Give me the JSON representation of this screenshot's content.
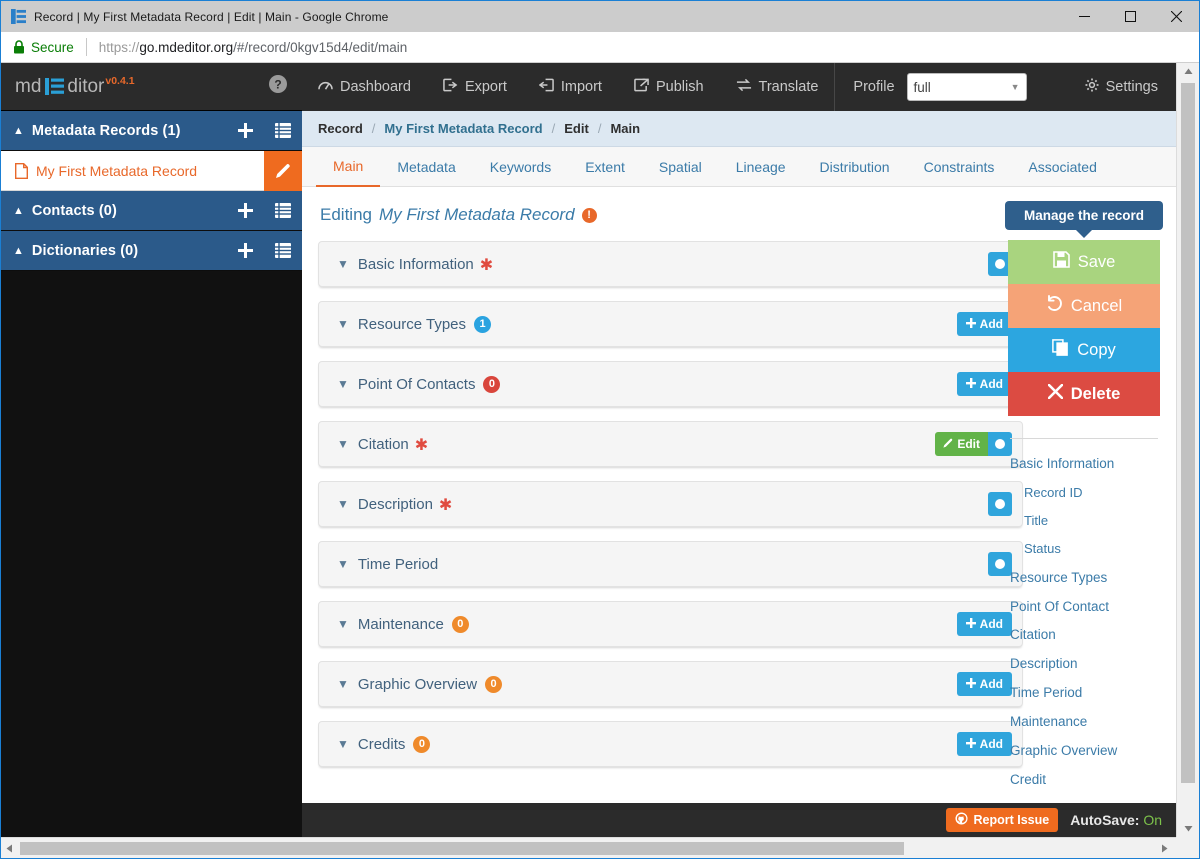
{
  "window": {
    "title": "Record | My First Metadata Record | Edit | Main - Google Chrome",
    "icon": "mdeditor-app-icon",
    "minimize": "minimize",
    "maximize": "maximize",
    "close": "close"
  },
  "browser": {
    "security_label": "Secure",
    "lock_icon": "lock-icon",
    "url_scheme": "https://",
    "url_domain": "go.mdeditor.org",
    "url_path": "/#/record/0kgv15d4/edit/main"
  },
  "brand": {
    "name_part1": "md",
    "logo_icon": "list-logo-icon",
    "name_part2": "ditor",
    "version": "v0.4.1",
    "help_icon": "help-circle-icon"
  },
  "sidebar": {
    "sections": [
      {
        "label": "Metadata Records (1)",
        "caret_icon": "chevron-up-icon",
        "add_icon": "plus-icon",
        "list_icon": "list-icon",
        "records": [
          {
            "label": "My First Metadata Record",
            "file_icon": "file-icon",
            "edit_icon": "pencil-icon"
          }
        ]
      },
      {
        "label": "Contacts (0)",
        "caret_icon": "chevron-up-icon",
        "add_icon": "plus-icon",
        "list_icon": "list-icon",
        "records": []
      },
      {
        "label": "Dictionaries (0)",
        "caret_icon": "chevron-up-icon",
        "add_icon": "plus-icon",
        "list_icon": "list-icon",
        "records": []
      }
    ]
  },
  "topnav": {
    "items": [
      {
        "label": "Dashboard",
        "icon": "dashboard-icon"
      },
      {
        "label": "Export",
        "icon": "export-icon"
      },
      {
        "label": "Import",
        "icon": "import-icon"
      },
      {
        "label": "Publish",
        "icon": "publish-icon"
      },
      {
        "label": "Translate",
        "icon": "translate-icon"
      }
    ],
    "profile_label": "Profile",
    "profile_value": "full",
    "profile_caret": "chevron-down-icon",
    "settings_label": "Settings",
    "settings_icon": "gear-icon"
  },
  "breadcrumb": {
    "items": [
      "Record",
      "My First Metadata Record",
      "Edit",
      "Main"
    ],
    "separator": "/"
  },
  "tabs": [
    {
      "label": "Main",
      "active": true
    },
    {
      "label": "Metadata",
      "active": false
    },
    {
      "label": "Keywords",
      "active": false
    },
    {
      "label": "Extent",
      "active": false
    },
    {
      "label": "Spatial",
      "active": false
    },
    {
      "label": "Lineage",
      "active": false
    },
    {
      "label": "Distribution",
      "active": false
    },
    {
      "label": "Constraints",
      "active": false
    },
    {
      "label": "Associated",
      "active": false
    }
  ],
  "editing": {
    "prefix": "Editing",
    "record_name": "My First Metadata Record",
    "warning_icon": "exclamation-circle-icon",
    "warning_glyph": "!"
  },
  "panels": [
    {
      "title": "Basic Information",
      "required": true,
      "badge": null,
      "badge_color": null,
      "action": "toggle",
      "caret_icon": "chevron-down-icon"
    },
    {
      "title": "Resource Types",
      "required": false,
      "badge": "1",
      "badge_color": "blue",
      "action": "add",
      "caret_icon": "chevron-down-icon"
    },
    {
      "title": "Point Of Contacts",
      "required": false,
      "badge": "0",
      "badge_color": "red",
      "action": "add",
      "caret_icon": "chevron-down-icon"
    },
    {
      "title": "Citation",
      "required": true,
      "badge": null,
      "badge_color": null,
      "action": "edit_toggle",
      "caret_icon": "chevron-down-icon"
    },
    {
      "title": "Description",
      "required": true,
      "badge": null,
      "badge_color": null,
      "action": "toggle",
      "caret_icon": "chevron-down-icon"
    },
    {
      "title": "Time Period",
      "required": false,
      "badge": null,
      "badge_color": null,
      "action": "toggle",
      "caret_icon": "chevron-down-icon"
    },
    {
      "title": "Maintenance",
      "required": false,
      "badge": "0",
      "badge_color": "orange",
      "action": "add",
      "caret_icon": "chevron-down-icon"
    },
    {
      "title": "Graphic Overview",
      "required": false,
      "badge": "0",
      "badge_color": "orange",
      "action": "add",
      "caret_icon": "chevron-down-icon"
    },
    {
      "title": "Credits",
      "required": false,
      "badge": "0",
      "badge_color": "orange",
      "action": "add",
      "caret_icon": "chevron-down-icon"
    }
  ],
  "panel_buttons": {
    "add_label": "Add",
    "add_icon": "plus-icon",
    "edit_label": "Edit",
    "edit_icon": "pencil-icon",
    "toggle_icon": "toggle-circle-icon"
  },
  "rail": {
    "tooltip": "Manage the record",
    "buttons": [
      {
        "label": "Save",
        "icon": "floppy-disk-icon",
        "color": "#a9d47f"
      },
      {
        "label": "Cancel",
        "icon": "undo-icon",
        "color": "#f5a377"
      },
      {
        "label": "Copy",
        "icon": "copy-icon",
        "color": "#2ca6e0"
      },
      {
        "label": "Delete",
        "icon": "times-icon",
        "color": "#dc4b42"
      }
    ],
    "nav": [
      {
        "label": "Basic Information",
        "sub": false
      },
      {
        "label": "Record ID",
        "sub": true
      },
      {
        "label": "Title",
        "sub": true
      },
      {
        "label": "Status",
        "sub": true
      },
      {
        "label": "Resource Types",
        "sub": false
      },
      {
        "label": "Point Of Contact",
        "sub": false
      },
      {
        "label": "Citation",
        "sub": false
      },
      {
        "label": "Description",
        "sub": false
      },
      {
        "label": "Time Period",
        "sub": false
      },
      {
        "label": "Maintenance",
        "sub": false
      },
      {
        "label": "Graphic Overview",
        "sub": false
      },
      {
        "label": "Credit",
        "sub": false
      }
    ]
  },
  "footer": {
    "report_label": "Report Issue",
    "report_icon": "github-icon",
    "autosave_label": "AutoSave:",
    "autosave_value": "On"
  },
  "colors": {
    "accent_orange": "#e8682a",
    "link_blue": "#3b7ba8",
    "sidebar_blue": "#2b5a8a",
    "dark_bar": "#2b2b2b",
    "panel_bg": "#f5f5f5"
  }
}
